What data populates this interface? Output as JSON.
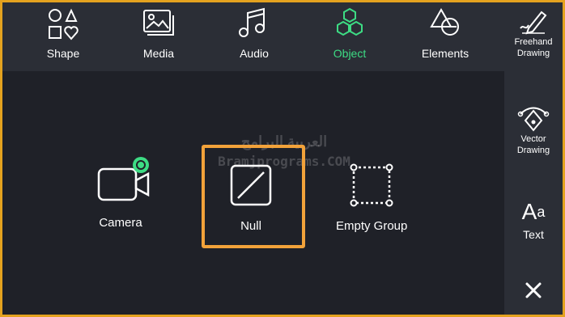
{
  "top_tabs": [
    {
      "label": "Shape",
      "icon": "shape-icon"
    },
    {
      "label": "Media",
      "icon": "media-icon"
    },
    {
      "label": "Audio",
      "icon": "audio-icon"
    },
    {
      "label": "Object",
      "icon": "object-icon",
      "active": true
    },
    {
      "label": "Elements",
      "icon": "elements-icon"
    }
  ],
  "side_tools": [
    {
      "label": "Freehand Drawing",
      "icon": "freehand-drawing-icon"
    },
    {
      "label": "Vector Drawing",
      "icon": "vector-drawing-icon"
    },
    {
      "label": "Text",
      "icon": "text-icon"
    }
  ],
  "objects": [
    {
      "label": "Camera",
      "icon": "camera-icon"
    },
    {
      "label": "Null",
      "icon": "null-icon",
      "selected": true
    },
    {
      "label": "Empty Group",
      "icon": "empty-group-icon"
    }
  ],
  "watermark": {
    "line1": "العربية البرامج",
    "line2": "Bramjprograms.COM"
  },
  "colors": {
    "accent": "#3ddc84",
    "selection": "#f2a23a",
    "frame": "#e4a21f",
    "background": "#1f2128",
    "toolbar": "#2b2e36"
  }
}
